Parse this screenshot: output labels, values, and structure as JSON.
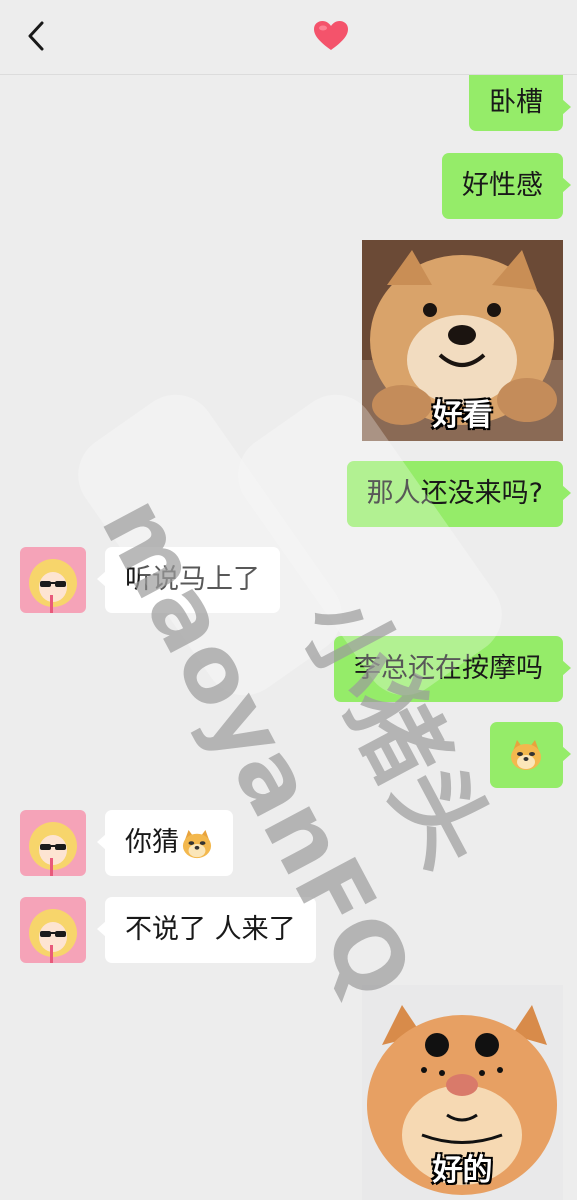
{
  "header": {
    "back_icon": "chevron-left-icon",
    "title_icon": "red-heart-icon",
    "accent": "#f4536b"
  },
  "colors": {
    "background": "#ededed",
    "my_bubble": "#95ec69",
    "their_bubble": "#ffffff"
  },
  "messages": [
    {
      "sender": "me",
      "text": "卧槽"
    },
    {
      "sender": "me",
      "text": "好性感"
    },
    {
      "sender": "me",
      "type": "sticker",
      "icon": "shiba-dog-sticker",
      "caption": "好看"
    },
    {
      "sender": "me",
      "text": "那人还没来吗?"
    },
    {
      "sender": "other",
      "text": "听说马上了"
    },
    {
      "sender": "me",
      "text": "李总还在按摩吗"
    },
    {
      "sender": "me",
      "type": "emoji",
      "icon": "doge-emoji"
    },
    {
      "sender": "other",
      "text": "你猜",
      "emoji": "doge-emoji"
    },
    {
      "sender": "other",
      "text": "不说了 人来了"
    },
    {
      "sender": "me",
      "type": "sticker",
      "icon": "cat-face-sticker",
      "caption": "好的"
    }
  ],
  "watermark": {
    "line1": "小猪头",
    "line2": "maoyanFQ"
  }
}
